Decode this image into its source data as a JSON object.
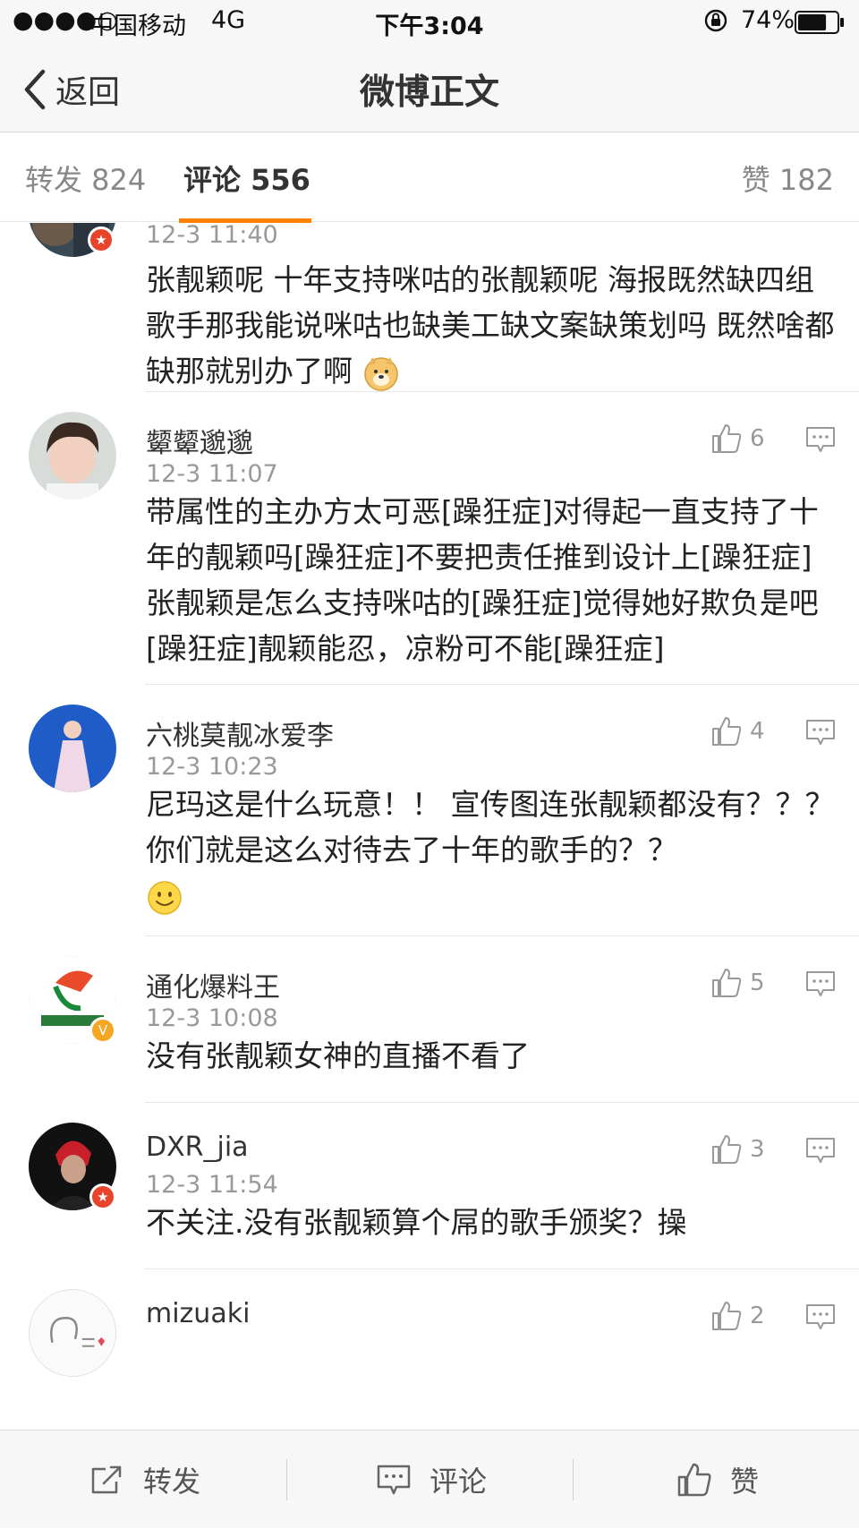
{
  "status_bar": {
    "signal": "●●●●○",
    "carrier": "中国移动",
    "network": "4G",
    "time": "下午3:04",
    "battery_percent": "74%",
    "battery_level": 0.74
  },
  "nav": {
    "back_label": "返回",
    "title": "微博正文"
  },
  "tabs": {
    "repost": "转发 824",
    "comment": "评论 556",
    "like": "赞 182",
    "active": "comment",
    "accent_color": "#ff8200"
  },
  "comments": [
    {
      "name": "",
      "time": "12-3 11:40",
      "text": "张靓颖呢 十年支持咪咕的张靓颖呢 海报既然缺四组歌手那我能说咪咕也缺美工缺文案缺策划吗 既然啥都缺那就别办了啊",
      "emoji": "doge-emoji",
      "badge": "red"
    },
    {
      "name": "颦颦邈邈",
      "time": "12-3 11:07",
      "likes": "6",
      "text": "带属性的主办方太可恶[躁狂症]对得起一直支持了十年的靓颖吗[躁狂症]不要把责任推到设计上[躁狂症]张靓颖是怎么支持咪咕的[躁狂症]觉得她好欺负是吧[躁狂症]靓颖能忍，凉粉可不能[躁狂症]"
    },
    {
      "name": "六桃莫靓冰爱李",
      "time": "12-3 10:23",
      "likes": "4",
      "text": "尼玛这是什么玩意！！ 宣传图连张靓颖都没有？？？ 你们就是这么对待去了十年的歌手的？？",
      "emoji": "smile-emoji"
    },
    {
      "name": "通化爆料王",
      "time": "12-3 10:08",
      "likes": "5",
      "text": "没有张靓颖女神的直播不看了",
      "badge": "gold"
    },
    {
      "name": "DXR_jia",
      "time": "12-3 11:54",
      "likes": "3",
      "text": "不关注.没有张靓颖算个屌的歌手颁奖？操",
      "badge": "red"
    },
    {
      "name": "mizuaki",
      "time": "",
      "likes": "2",
      "text": ""
    }
  ],
  "toolbar": {
    "repost": "转发",
    "comment": "评论",
    "like": "赞"
  },
  "icons": {
    "back": "chevron-left-icon",
    "lock": "orientation-lock-icon",
    "battery": "battery-icon",
    "thumb": "thumbs-up-icon",
    "reply": "comment-bubble-icon",
    "share": "share-icon"
  }
}
